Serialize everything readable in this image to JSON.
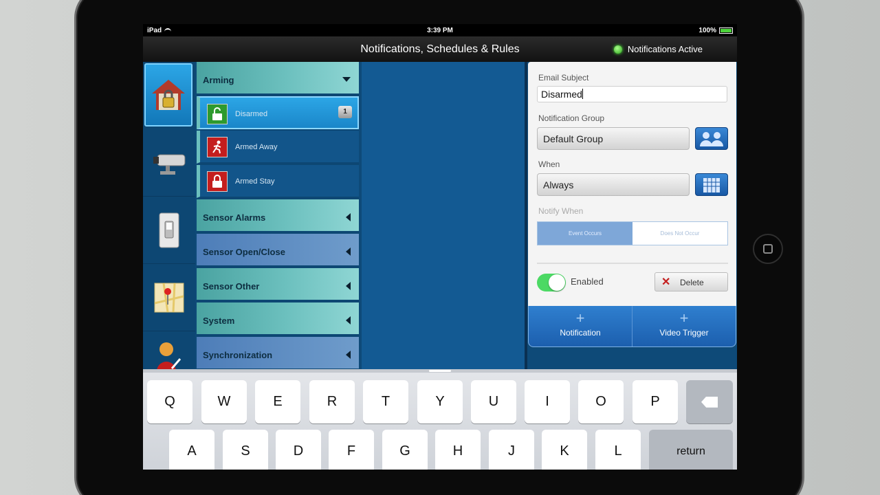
{
  "statusbar": {
    "device": "iPad",
    "time": "3:39 PM",
    "battery": "100%"
  },
  "titlebar": {
    "title": "Notifications, Schedules & Rules",
    "status": "Notifications Active"
  },
  "nav_icons": [
    "house-lock-icon",
    "security-camera-icon",
    "light-switch-icon",
    "map-pin-icon",
    "user-icon"
  ],
  "categories": {
    "arming": "Arming",
    "arming_items": [
      {
        "label": "Disarmed",
        "badge": "1",
        "icon": "unlocked-icon",
        "color": "#2e9a2e"
      },
      {
        "label": "Armed Away",
        "icon": "running-man-icon",
        "color": "#c41e1e"
      },
      {
        "label": "Armed Stay",
        "icon": "locked-icon",
        "color": "#c41e1e"
      }
    ],
    "sensor_alarms": "Sensor Alarms",
    "sensor_open_close": "Sensor Open/Close",
    "sensor_other": "Sensor Other",
    "system": "System",
    "synchronization": "Synchronization"
  },
  "detail": {
    "email_subject_label": "Email Subject",
    "email_subject_value": "Disarmed",
    "group_label": "Notification Group",
    "group_value": "Default Group",
    "when_label": "When",
    "when_value": "Always",
    "notify_when_label": "Notify When",
    "event_occurs": "Event Occurs",
    "does_not_occur": "Does Not Occur",
    "enabled_label": "Enabled",
    "delete_label": "Delete"
  },
  "add_buttons": {
    "notification": "Notification",
    "video_trigger": "Video Trigger"
  },
  "keyboard": {
    "row1": [
      "Q",
      "W",
      "E",
      "R",
      "T",
      "Y",
      "U",
      "I",
      "O",
      "P"
    ],
    "row2": [
      "A",
      "S",
      "D",
      "F",
      "G",
      "H",
      "J",
      "K",
      "L"
    ],
    "return": "return"
  },
  "colors": {
    "accent_blue": "#1a86c9",
    "teal": "#6cc0be",
    "toggle_on": "#4cd964",
    "led": "#2ea51c"
  }
}
